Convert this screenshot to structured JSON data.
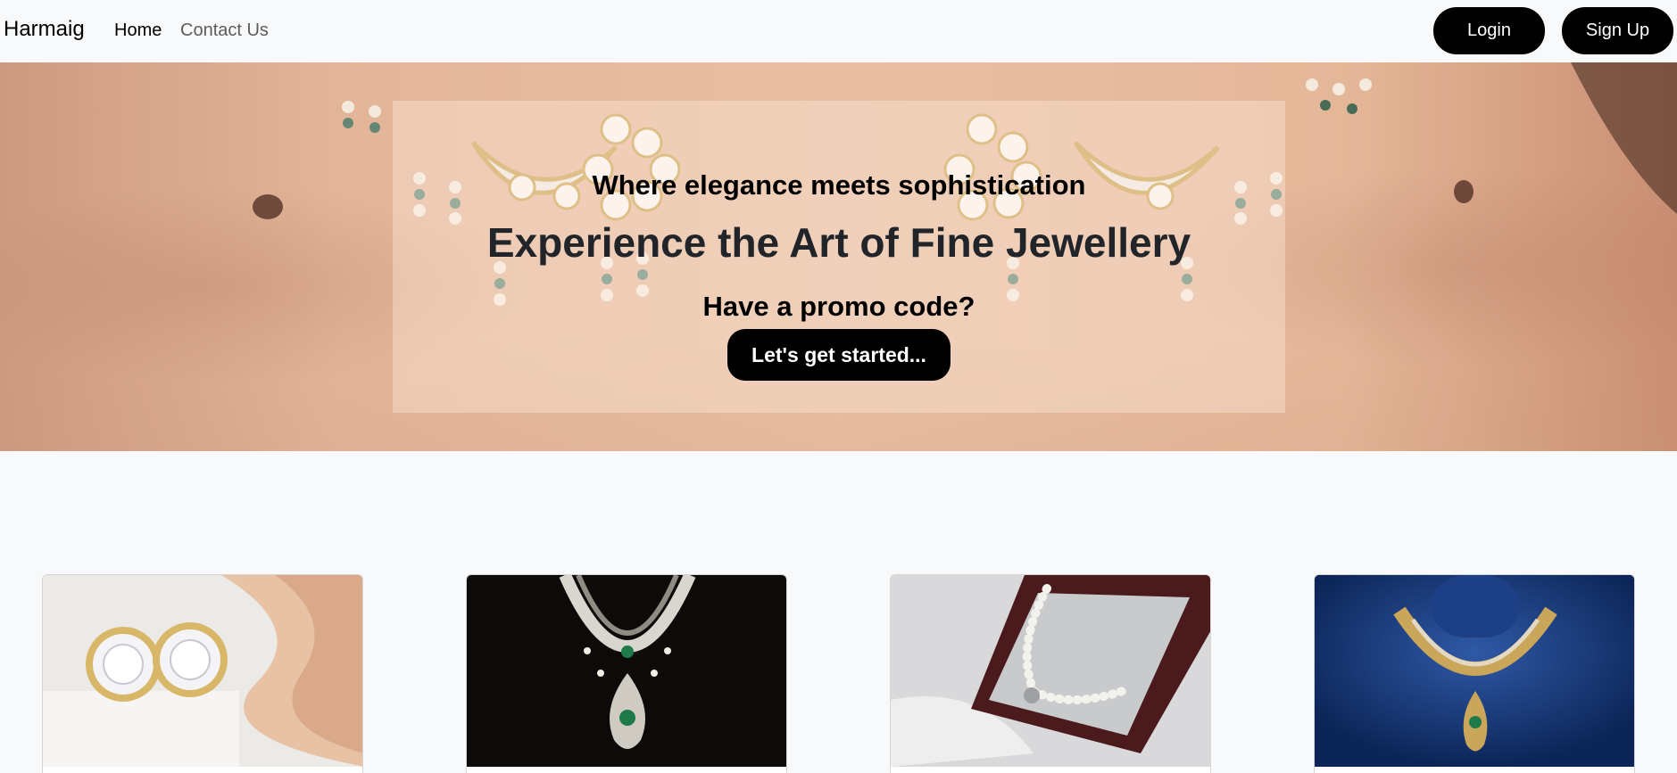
{
  "navbar": {
    "brand": "Harmaig",
    "links": [
      "Home",
      "Contact Us"
    ],
    "login_label": "Login",
    "signup_label": "Sign Up"
  },
  "hero": {
    "tagline": "Where elegance meets sophistication",
    "headline": "Experience the Art of Fine Jewellery",
    "promo_text": "Have a promo code?",
    "cta_label": "Let's get started..."
  },
  "products": [
    {
      "image": "diamond-stud-earrings"
    },
    {
      "image": "diamond-emerald-necklace-black"
    },
    {
      "image": "pearl-necklace-in-box"
    },
    {
      "image": "diamond-emerald-necklace-blue"
    }
  ],
  "colors": {
    "navbar_bg": "#f8f9fa",
    "button_bg": "#000000",
    "button_text": "#ffffff"
  }
}
